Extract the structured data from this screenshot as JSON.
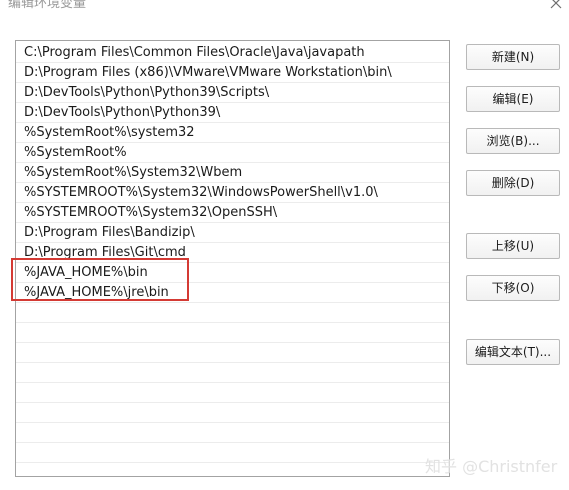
{
  "dialog": {
    "title": "编辑环境变量"
  },
  "list": {
    "items": [
      "C:\\Program Files\\Common Files\\Oracle\\Java\\javapath",
      "D:\\Program Files (x86)\\VMware\\VMware Workstation\\bin\\",
      "D:\\DevTools\\Python\\Python39\\Scripts\\",
      "D:\\DevTools\\Python\\Python39\\",
      "%SystemRoot%\\system32",
      "%SystemRoot%",
      "%SystemRoot%\\System32\\Wbem",
      "%SYSTEMROOT%\\System32\\WindowsPowerShell\\v1.0\\",
      "%SYSTEMROOT%\\System32\\OpenSSH\\",
      "D:\\Program Files\\Bandizip\\",
      "D:\\Program Files\\Git\\cmd",
      "%JAVA_HOME%\\bin",
      "%JAVA_HOME%\\jre\\bin"
    ],
    "empty_rows": 9,
    "highlight_color": "#d43a34"
  },
  "buttons": {
    "new": "新建(N)",
    "edit": "编辑(E)",
    "browse": "浏览(B)...",
    "delete": "删除(D)",
    "move_up": "上移(U)",
    "move_down": "下移(O)",
    "edit_text": "编辑文本(T)..."
  },
  "watermark": "知乎 @Christnfer"
}
